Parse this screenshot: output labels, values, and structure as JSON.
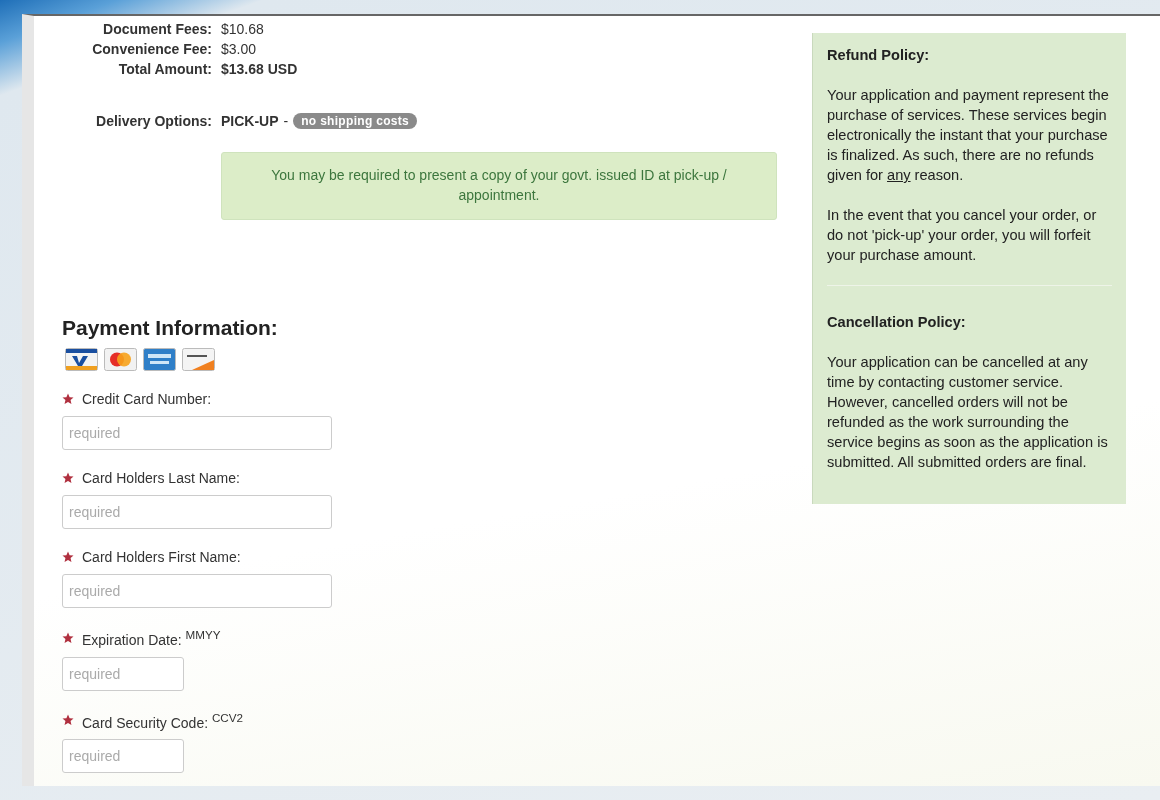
{
  "fees": [
    {
      "label": "Document Fees:",
      "value": "$10.68",
      "emphasis": false
    },
    {
      "label": "Convenience Fee:",
      "value": "$3.00",
      "emphasis": false
    },
    {
      "label": "Total Amount:",
      "value": "$13.68 USD",
      "emphasis": true
    }
  ],
  "delivery": {
    "label": "Delivery Options:",
    "value": "PICK-UP",
    "separator": "-",
    "badge": "no shipping costs"
  },
  "notice": "You may be required to present a copy of your govt. issued ID at pick-up / appointment.",
  "payment": {
    "title": "Payment Information:",
    "fields": [
      {
        "label": "Credit Card Number:",
        "placeholder": "required",
        "required": true,
        "kind": "wide"
      },
      {
        "label": "Card Holders Last Name:",
        "placeholder": "required",
        "required": true,
        "kind": "wide"
      },
      {
        "label": "Card Holders First Name:",
        "placeholder": "required",
        "required": true,
        "kind": "wide"
      },
      {
        "label": "Expiration Date: $^{MMYY}$",
        "placeholder": "required",
        "required": true,
        "kind": "short"
      },
      {
        "label": "Card Security Code: $^{CCV2}$",
        "placeholder": "required",
        "required": true,
        "kind": "short"
      }
    ]
  },
  "sidebar": {
    "sections": [
      {
        "title": "Refund Policy:",
        "paragraphs": [
          {
            "before": "Your application and payment represent the purchase of services. These services begin electronically the instant that your purchase is finalized. As such, there are no refunds given for ",
            "underlined": "any",
            "after": " reason."
          },
          {
            "before": "In the event that you cancel your order, or do not 'pick-up' your order, you will forfeit your purchase amount."
          }
        ]
      },
      {
        "title": "Cancellation Policy:",
        "paragraphs": [
          {
            "before": "Your application can be cancelled at any time by contacting customer service. However, cancelled orders will not be refunded as the work surrounding the service begins as soon as the application is submitted. All submitted orders are final."
          }
        ]
      }
    ]
  }
}
